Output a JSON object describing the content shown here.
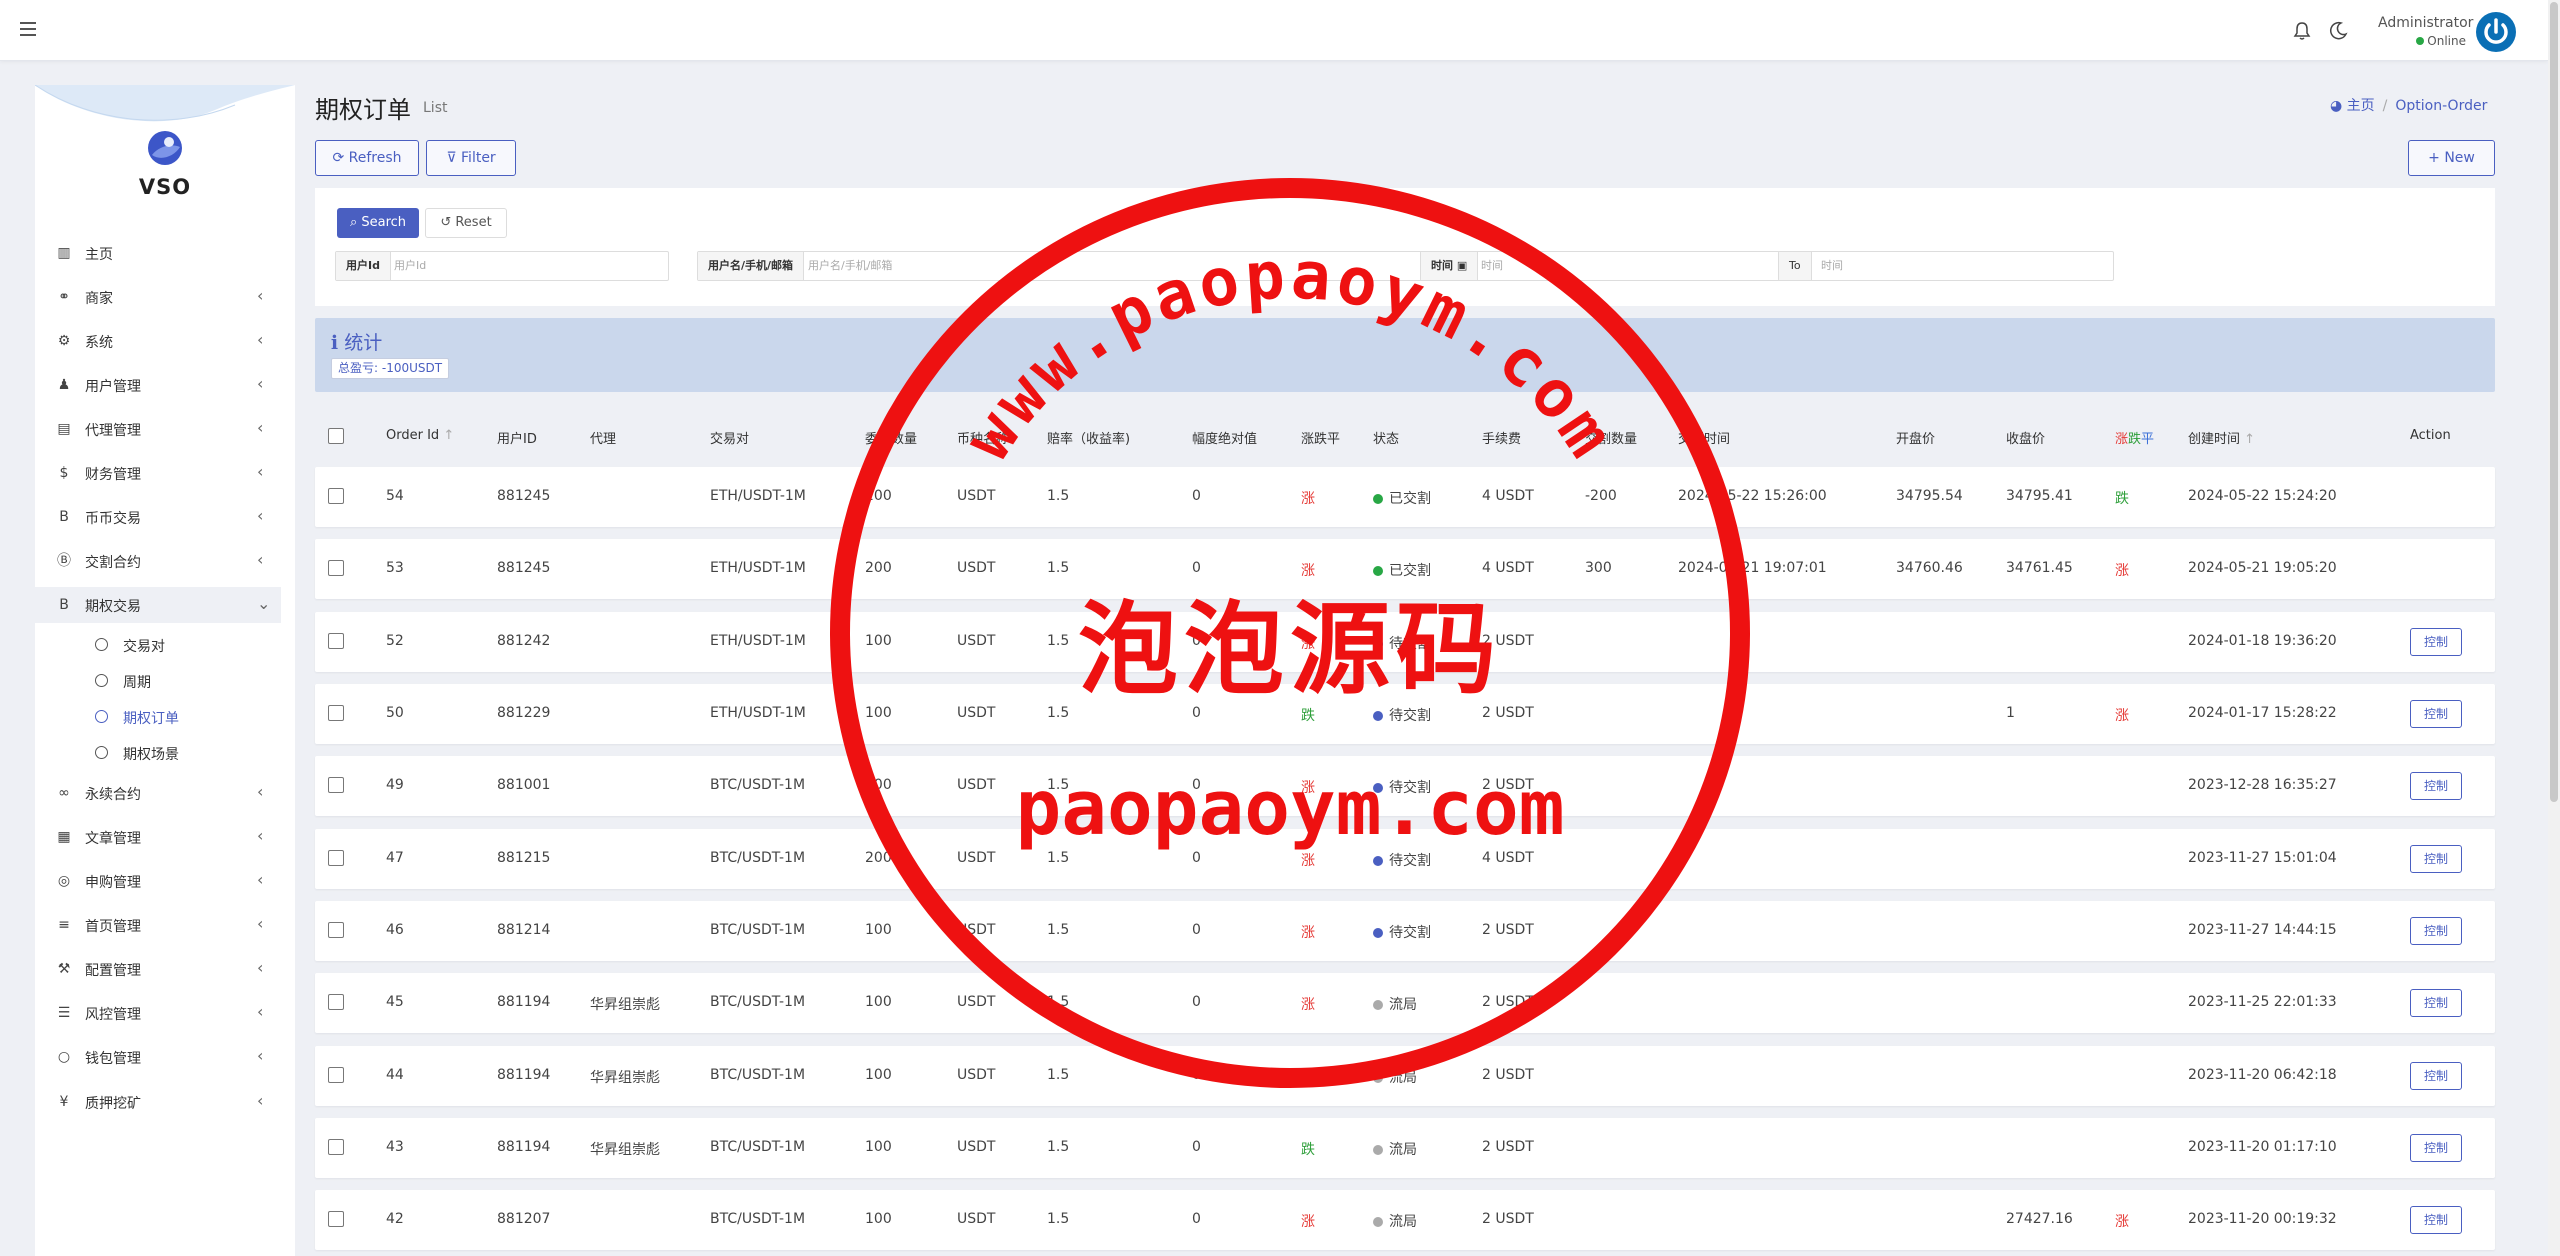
{
  "header": {
    "admin_name": "Administrator",
    "admin_status": "Online",
    "icons": [
      "menu-icon",
      "bell-icon",
      "moon-icon",
      "power-icon"
    ]
  },
  "sidebar": {
    "brand": "VSO",
    "items": [
      {
        "label": "主页",
        "icon": "chart-icon"
      },
      {
        "label": "商家",
        "icon": "handshake-icon"
      },
      {
        "label": "系统",
        "icon": "gear-icon"
      },
      {
        "label": "用户管理",
        "icon": "users-icon"
      },
      {
        "label": "代理管理",
        "icon": "id-card-icon"
      },
      {
        "label": "财务管理",
        "icon": "dollar-icon"
      },
      {
        "label": "币币交易",
        "icon": "bitcoin-icon"
      },
      {
        "label": "交割合约",
        "icon": "bitcoin-circle-icon"
      },
      {
        "label": "期权交易",
        "icon": "bitcoin-icon"
      },
      {
        "label": "永续合约",
        "icon": "link-icon"
      },
      {
        "label": "文章管理",
        "icon": "newspaper-icon"
      },
      {
        "label": "申购管理",
        "icon": "lifebuoy-icon"
      },
      {
        "label": "首页管理",
        "icon": "list-icon"
      },
      {
        "label": "配置管理",
        "icon": "wrench-icon"
      },
      {
        "label": "风控管理",
        "icon": "list-alt-icon"
      },
      {
        "label": "钱包管理",
        "icon": "circle-icon"
      },
      {
        "label": "质押挖矿",
        "icon": "yen-icon"
      }
    ],
    "subitems": [
      {
        "label": "交易对",
        "active": false
      },
      {
        "label": "周期",
        "active": false
      },
      {
        "label": "期权订单",
        "active": true
      },
      {
        "label": "期权场景",
        "active": false
      }
    ]
  },
  "page": {
    "title": "期权订单",
    "subtitle": "List",
    "breadcrumb_home": "主页",
    "breadcrumb_current": "Option-Order",
    "refresh_label": "Refresh",
    "filter_label": "Filter",
    "new_label": "New"
  },
  "search": {
    "search_label": "Search",
    "reset_label": "Reset",
    "user_id_label": "用户Id",
    "user_id_placeholder": "用户Id",
    "user_name_label": "用户名/手机/邮箱",
    "user_name_placeholder": "用户名/手机/邮箱",
    "time_label": "时间",
    "time_placeholder": "时间",
    "to_label": "To",
    "to_placeholder": "时间"
  },
  "stats": {
    "title": "统计",
    "badge": "总盈亏: -100USDT"
  },
  "table": {
    "headers": {
      "order_id": "Order Id",
      "user_id": "用户ID",
      "agent": "代理",
      "pair": "交易对",
      "amount": "委托数量",
      "currency": "币种名称",
      "odds": "赔率（收益率)",
      "range": "幅度绝对值",
      "direction": "涨跌平",
      "state": "状态",
      "fee": "手续费",
      "settle_qty": "交割数量",
      "settle_time": "交割时间",
      "open_price": "开盘价",
      "close_price": "收盘价",
      "result_rise": "涨",
      "result_fall": "跌",
      "result_flat": "平",
      "created": "创建时间",
      "action": "Action"
    },
    "control_label": "控制",
    "status_colors": {
      "已交割": "#28a745",
      "待交割": "#4a5fc1",
      "流局": "#aaaaaa"
    },
    "rows": [
      {
        "id": "54",
        "uid": "881245",
        "agent": "",
        "pair": "ETH/USDT-1M",
        "amount": "200",
        "currency": "USDT",
        "odds": "1.5",
        "range": "0",
        "dir": "涨",
        "state": "已交割",
        "fee": "4 USDT",
        "settle_qty": "-200",
        "settle_time": "2024-05-22 15:26:00",
        "open": "34795.54",
        "close": "34795.41",
        "result": "跌",
        "created": "2024-05-22 15:24:20",
        "control": false
      },
      {
        "id": "53",
        "uid": "881245",
        "agent": "",
        "pair": "ETH/USDT-1M",
        "amount": "200",
        "currency": "USDT",
        "odds": "1.5",
        "range": "0",
        "dir": "涨",
        "state": "已交割",
        "fee": "4 USDT",
        "settle_qty": "300",
        "settle_time": "2024-05-21 19:07:01",
        "open": "34760.46",
        "close": "34761.45",
        "result": "涨",
        "created": "2024-05-21 19:05:20",
        "control": false
      },
      {
        "id": "52",
        "uid": "881242",
        "agent": "",
        "pair": "ETH/USDT-1M",
        "amount": "100",
        "currency": "USDT",
        "odds": "1.5",
        "range": "0",
        "dir": "涨",
        "state": "待交割",
        "fee": "2 USDT",
        "settle_qty": "",
        "settle_time": "",
        "open": "",
        "close": "",
        "result": "",
        "created": "2024-01-18 19:36:20",
        "control": true
      },
      {
        "id": "50",
        "uid": "881229",
        "agent": "",
        "pair": "ETH/USDT-1M",
        "amount": "100",
        "currency": "USDT",
        "odds": "1.5",
        "range": "0",
        "dir": "跌",
        "state": "待交割",
        "fee": "2 USDT",
        "settle_qty": "",
        "settle_time": "",
        "open": "",
        "close": "1",
        "result": "涨",
        "created": "2024-01-17 15:28:22",
        "control": true
      },
      {
        "id": "49",
        "uid": "881001",
        "agent": "",
        "pair": "BTC/USDT-1M",
        "amount": "100",
        "currency": "USDT",
        "odds": "1.5",
        "range": "0",
        "dir": "涨",
        "state": "待交割",
        "fee": "2 USDT",
        "settle_qty": "",
        "settle_time": "",
        "open": "",
        "close": "",
        "result": "",
        "created": "2023-12-28 16:35:27",
        "control": true
      },
      {
        "id": "47",
        "uid": "881215",
        "agent": "",
        "pair": "BTC/USDT-1M",
        "amount": "200",
        "currency": "USDT",
        "odds": "1.5",
        "range": "0",
        "dir": "涨",
        "state": "待交割",
        "fee": "4 USDT",
        "settle_qty": "",
        "settle_time": "",
        "open": "",
        "close": "",
        "result": "",
        "created": "2023-11-27 15:01:04",
        "control": true
      },
      {
        "id": "46",
        "uid": "881214",
        "agent": "",
        "pair": "BTC/USDT-1M",
        "amount": "100",
        "currency": "USDT",
        "odds": "1.5",
        "range": "0",
        "dir": "涨",
        "state": "待交割",
        "fee": "2 USDT",
        "settle_qty": "",
        "settle_time": "",
        "open": "",
        "close": "",
        "result": "",
        "created": "2023-11-27 14:44:15",
        "control": true
      },
      {
        "id": "45",
        "uid": "881194",
        "agent": "华昇组崇彪",
        "pair": "BTC/USDT-1M",
        "amount": "100",
        "currency": "USDT",
        "odds": "1.5",
        "range": "0",
        "dir": "涨",
        "state": "流局",
        "fee": "2 USDT",
        "settle_qty": "",
        "settle_time": "",
        "open": "",
        "close": "",
        "result": "",
        "created": "2023-11-25 22:01:33",
        "control": true
      },
      {
        "id": "44",
        "uid": "881194",
        "agent": "华昇组崇彪",
        "pair": "BTC/USDT-1M",
        "amount": "100",
        "currency": "USDT",
        "odds": "1.5",
        "range": "0",
        "dir": "",
        "state": "流局",
        "fee": "2 USDT",
        "settle_qty": "",
        "settle_time": "",
        "open": "",
        "close": "",
        "result": "",
        "created": "2023-11-20 06:42:18",
        "control": true
      },
      {
        "id": "43",
        "uid": "881194",
        "agent": "华昇组崇彪",
        "pair": "BTC/USDT-1M",
        "amount": "100",
        "currency": "USDT",
        "odds": "1.5",
        "range": "0",
        "dir": "跌",
        "state": "流局",
        "fee": "2 USDT",
        "settle_qty": "",
        "settle_time": "",
        "open": "",
        "close": "",
        "result": "",
        "created": "2023-11-20 01:17:10",
        "control": true
      },
      {
        "id": "42",
        "uid": "881207",
        "agent": "",
        "pair": "BTC/USDT-1M",
        "amount": "100",
        "currency": "USDT",
        "odds": "1.5",
        "range": "0",
        "dir": "涨",
        "state": "流局",
        "fee": "2 USDT",
        "settle_qty": "",
        "settle_time": "",
        "open": "",
        "close": "27427.16",
        "result": "涨",
        "created": "2023-11-20 00:19:32",
        "control": true
      }
    ]
  },
  "watermark": {
    "arc_text": "www.paopaoym.com",
    "cn_text": "泡泡源码",
    "url_text": "paopaoym.com",
    "color": "#ee1111"
  }
}
